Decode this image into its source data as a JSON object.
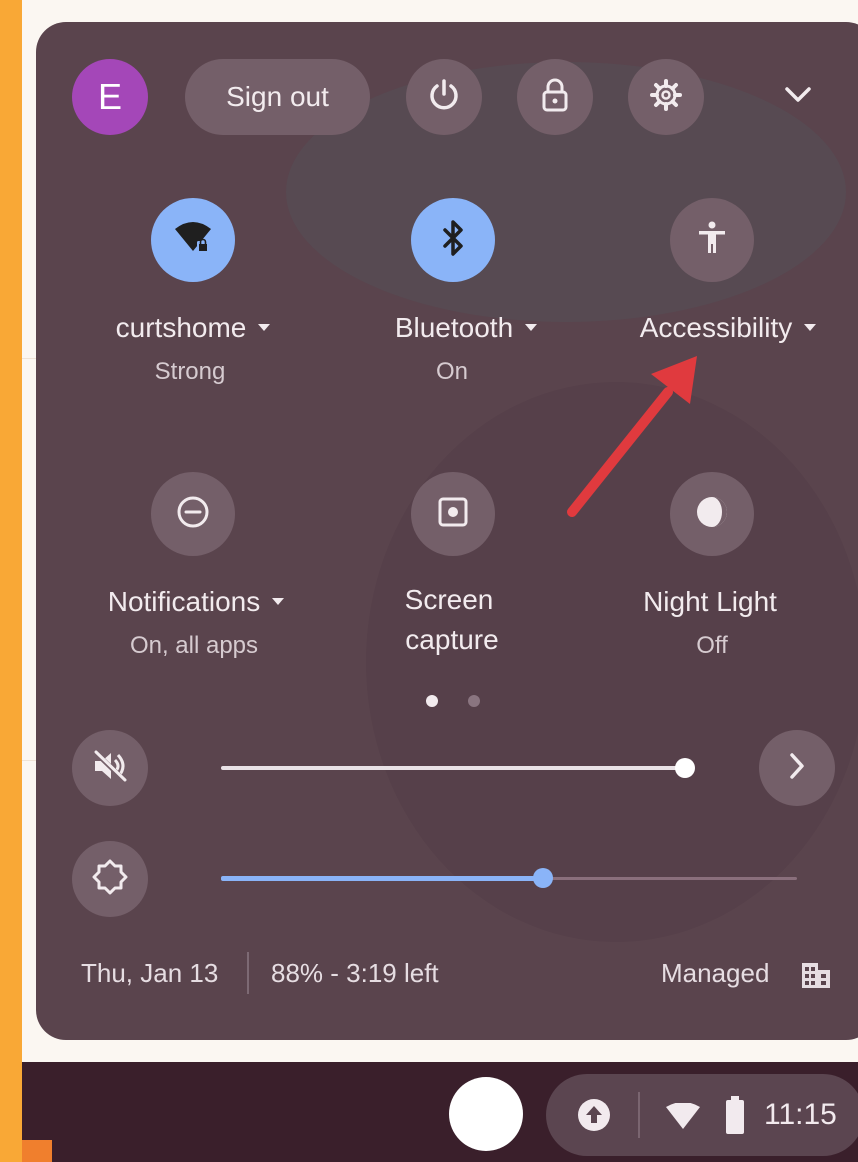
{
  "header": {
    "avatar_initial": "E",
    "sign_out_label": "Sign out"
  },
  "tiles_row1": [
    {
      "label": "curtshome",
      "sub": "Strong"
    },
    {
      "label": "Bluetooth",
      "sub": "On"
    },
    {
      "label": "Accessibility",
      "sub": ""
    }
  ],
  "tiles_row2": [
    {
      "label": "Notifications",
      "sub": "On, all apps"
    },
    {
      "label_line1": "Screen",
      "label_line2": "capture"
    },
    {
      "label": "Night Light",
      "sub": "Off"
    }
  ],
  "pager": {
    "pages": 2,
    "current": 1
  },
  "volume": {
    "level": 1.0,
    "muted": true
  },
  "brightness": {
    "level": 0.56
  },
  "footer": {
    "date": "Thu, Jan 13",
    "battery": "88% - 3:19 left",
    "managed": "Managed"
  },
  "shelf": {
    "time": "11:15"
  },
  "colors": {
    "panel": "#5a444d",
    "active_tile": "#8ab4f8",
    "avatar": "#a447b8",
    "arrow": "#e03a3e",
    "background": "#f9a836"
  }
}
